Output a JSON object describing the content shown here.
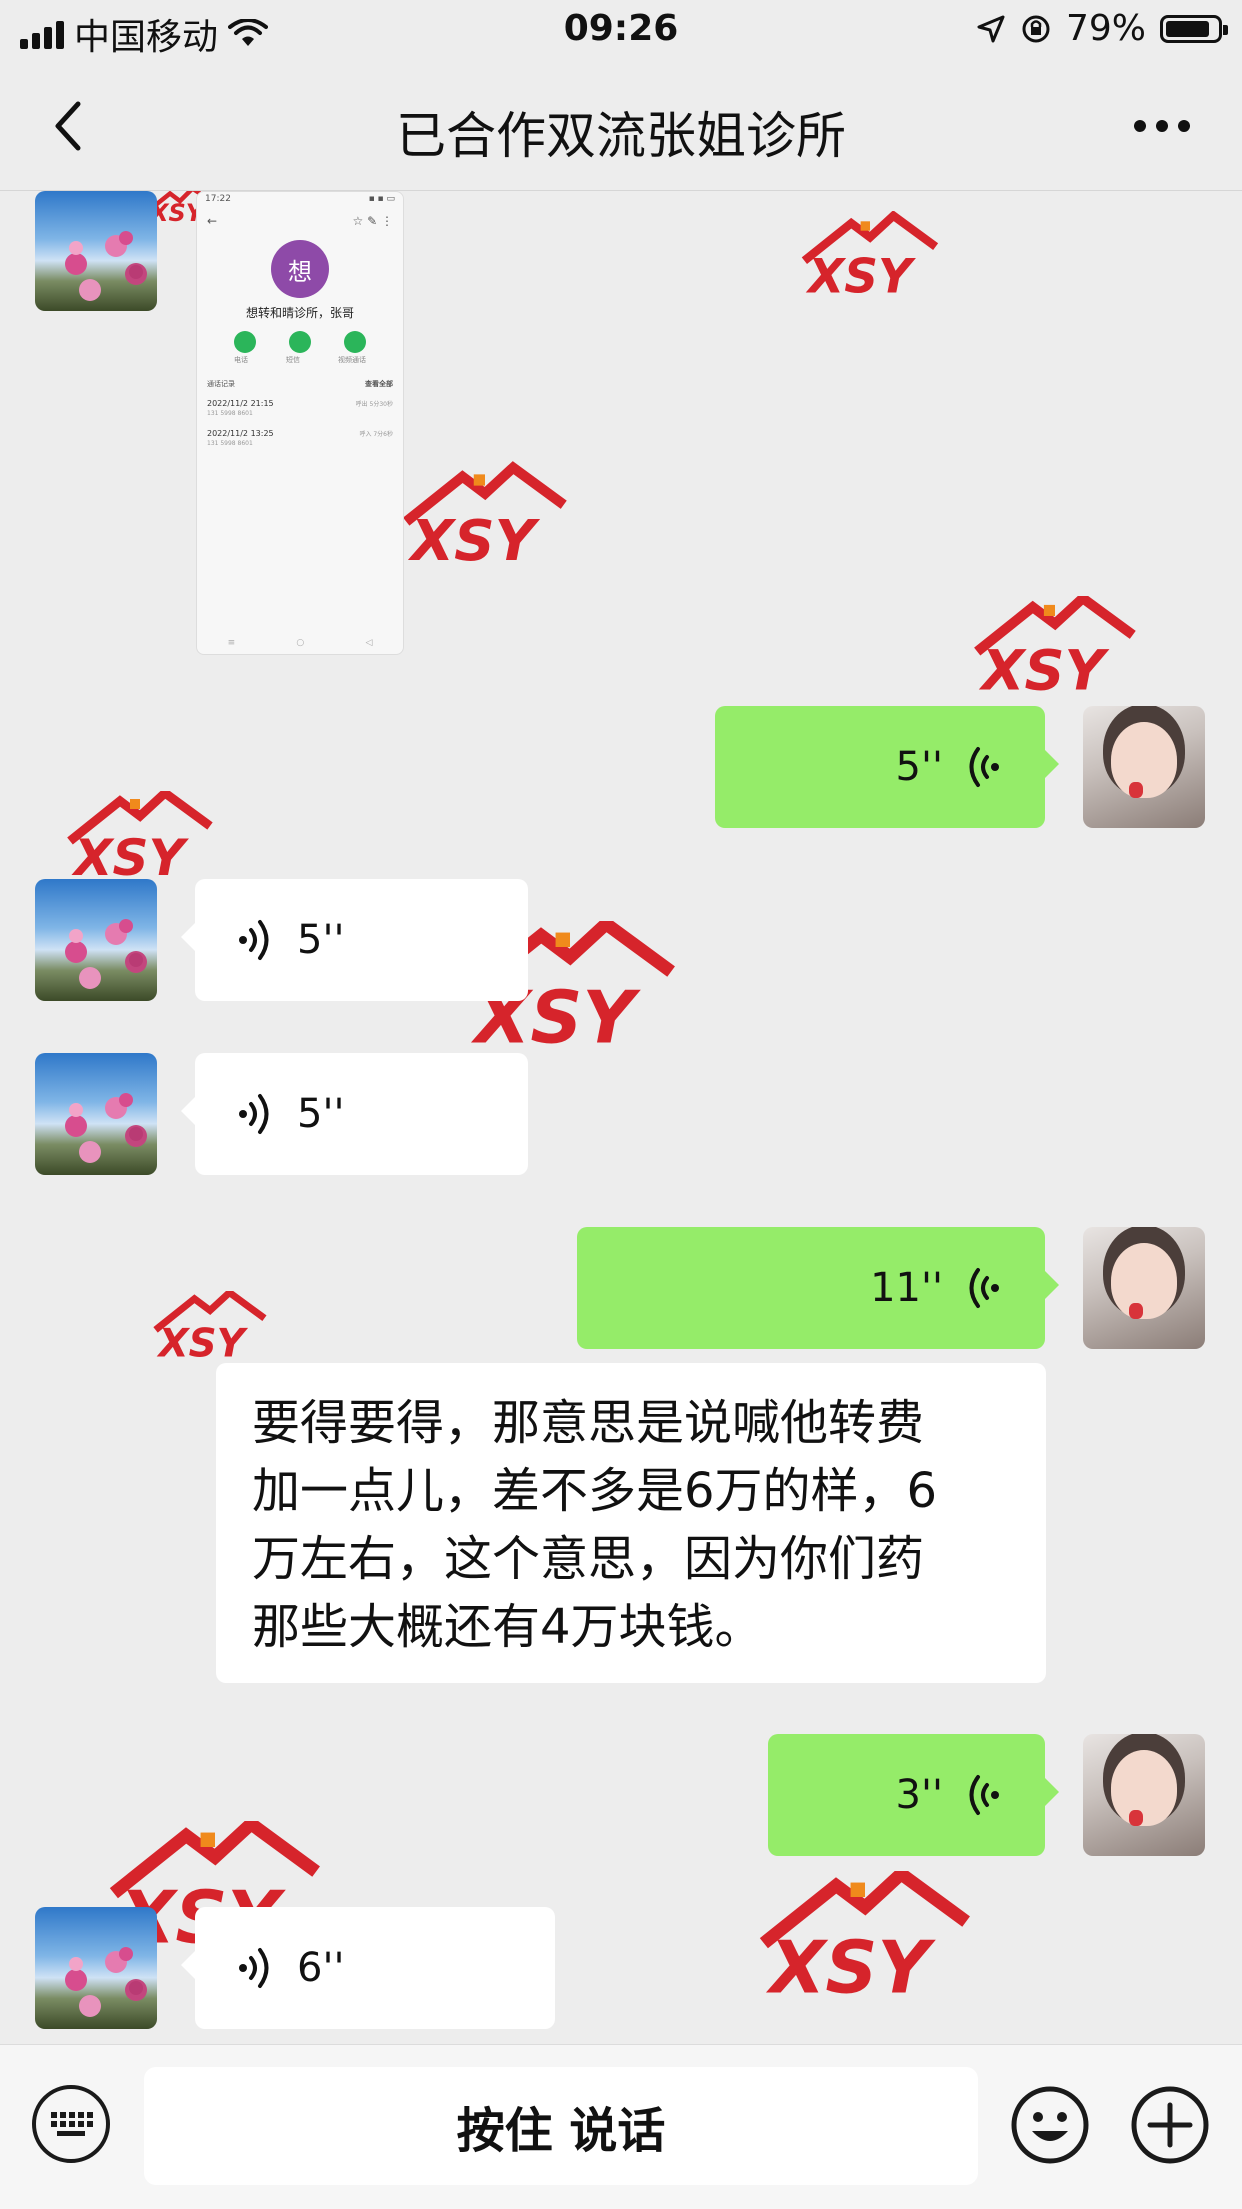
{
  "status_bar": {
    "carrier": "中国移动",
    "time": "09:26",
    "battery": "79%",
    "battery_level": 0.79
  },
  "nav": {
    "title": "已合作双流张姐诊所"
  },
  "shared_image": {
    "time": "17:22",
    "contact_initial": "想",
    "contact_name": "想转和晴诊所，张哥",
    "action_labels": [
      "电话",
      "短信",
      "视频通话"
    ],
    "section_title": "通话记录",
    "section_link": "查看全部",
    "calls": [
      {
        "date": "2022/11/2 21:15",
        "number": "131 5998 8601",
        "detail": "呼出 5分30秒"
      },
      {
        "date": "2022/11/2 13:25",
        "number": "131 5998 8601",
        "detail": "呼入 7分6秒"
      }
    ]
  },
  "messages": [
    {
      "kind": "voice",
      "direction": "out",
      "duration": "5''"
    },
    {
      "kind": "voice",
      "direction": "in",
      "duration": "5''"
    },
    {
      "kind": "voice",
      "direction": "in",
      "duration": "5''"
    },
    {
      "kind": "voice",
      "direction": "out",
      "duration": "11''"
    },
    {
      "kind": "text",
      "direction": "in",
      "lines": [
        "要得要得，那意思是说喊他转费",
        "加一点儿，差不多是6万的样，6",
        "万左右，这个意思，因为你们药",
        "那些大概还有4万块钱。"
      ]
    },
    {
      "kind": "voice",
      "direction": "out",
      "duration": "3''"
    },
    {
      "kind": "voice",
      "direction": "in",
      "duration": "6''"
    }
  ],
  "input_bar": {
    "hold_to_talk": "按住 说话"
  },
  "icons": {
    "back": "chevron-left-icon",
    "more": "more-dots-icon",
    "keyboard": "keyboard-icon",
    "emoji": "emoji-icon",
    "plus": "plus-icon",
    "voice_in": "voice-wave-icon",
    "voice_out": "voice-wave-icon"
  },
  "colors": {
    "background": "#ededed",
    "out_bubble": "#95ec69",
    "in_bubble": "#ffffff",
    "watermark": "#d6242b",
    "watermark_accent": "#f08a1c"
  }
}
